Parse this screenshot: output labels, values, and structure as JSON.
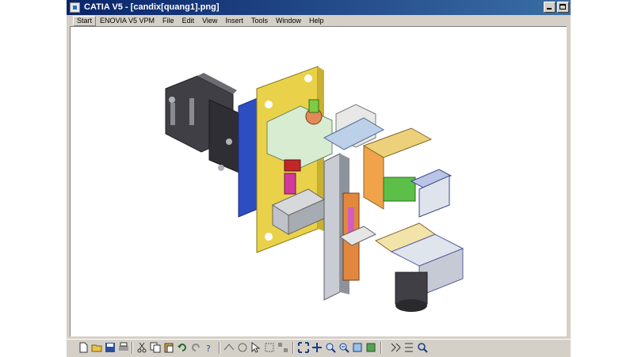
{
  "window": {
    "title": "CATIA V5 - [candix[quang1].png]"
  },
  "menu": {
    "items": [
      "Start",
      "ENOVIA V5 VPM",
      "File",
      "Edit",
      "View",
      "Insert",
      "Tools",
      "Window",
      "Help"
    ]
  },
  "toolbar": {
    "icons": [
      "new-icon",
      "open-icon",
      "save-icon",
      "print-icon",
      "cut-icon",
      "copy-icon",
      "paste-icon",
      "undo-icon",
      "redo-icon",
      "whats-this-icon",
      "fly-icon",
      "rotate-icon",
      "select-icon",
      "fit-all-icon",
      "pan-icon",
      "zoom-in-icon",
      "zoom-out-icon",
      "normal-view-icon",
      "multi-view-icon",
      "apply-material-icon",
      "catalog-icon",
      "search-icon"
    ]
  },
  "colors": {
    "title_start": "#0a246a",
    "title_end": "#3a6ea5",
    "chrome": "#d4d0c8",
    "viewport_bg": "#ffffff"
  },
  "viewport": {
    "content": "3D mechanical assembly"
  }
}
